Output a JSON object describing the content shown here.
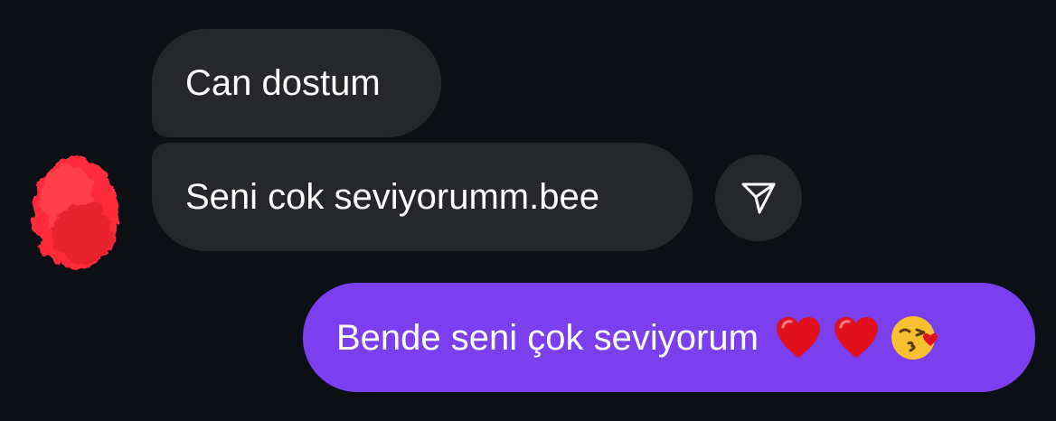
{
  "conversation": {
    "messages": [
      {
        "sender": "other",
        "text": "Can dostum"
      },
      {
        "sender": "other",
        "text": "Seni cok seviyorumm.bee"
      },
      {
        "sender": "me",
        "text": "Bende seni çok seviyorum",
        "emojis": [
          "red-heart",
          "red-heart",
          "face-blowing-kiss"
        ]
      }
    ]
  },
  "icons": {
    "share": "paper-plane-icon"
  },
  "colors": {
    "background": "#0c0f14",
    "incoming_bubble": "#25272b",
    "outgoing_bubble": "#7b3ff0",
    "avatar_redaction": "#ff2a3a"
  }
}
